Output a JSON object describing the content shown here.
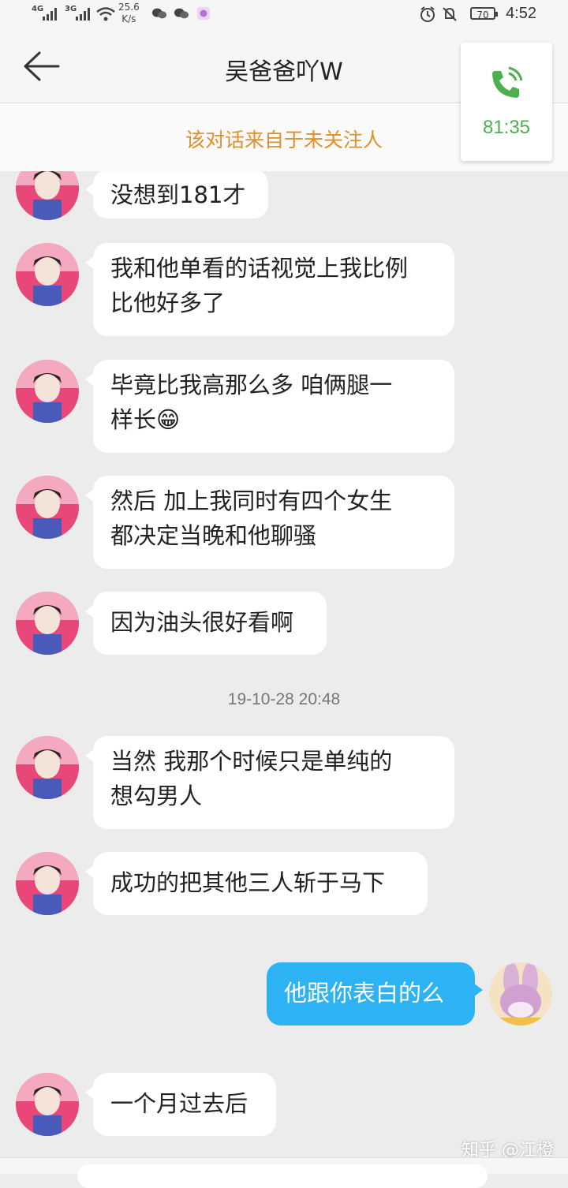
{
  "status_bar": {
    "sim1": "4G",
    "sim2": "3G",
    "speed_value": "25.6",
    "speed_unit": "K/s",
    "battery": "70",
    "time": "4:52",
    "icons": [
      "signal-icon",
      "wifi-icon",
      "wechat-icon",
      "wechat-icon",
      "app-icon",
      "alarm-icon",
      "mute-icon",
      "battery-icon"
    ]
  },
  "header": {
    "title": "吴爸爸吖W",
    "back_icon": "back-arrow-icon"
  },
  "notice": "该对话来自于未关注人",
  "call_card": {
    "icon": "phone-icon",
    "duration": "81:35",
    "accent": "#4caf50"
  },
  "messages": [
    {
      "side": "left",
      "lines": [
        "没想到181才"
      ]
    },
    {
      "side": "left",
      "lines": [
        "我和他单看的话视觉上我比例",
        "比他好多了"
      ]
    },
    {
      "side": "left",
      "lines": [
        "毕竟比我高那么多 咱俩腿一",
        "样长😁"
      ]
    },
    {
      "side": "left",
      "lines": [
        "然后 加上我同时有四个女生",
        "都决定当晚和他聊骚"
      ]
    },
    {
      "side": "left",
      "lines": [
        "因为油头很好看啊"
      ]
    },
    {
      "timestamp": "19-10-28 20:48"
    },
    {
      "side": "left",
      "lines": [
        "当然 我那个时候只是单纯的",
        "想勾男人"
      ]
    },
    {
      "side": "left",
      "lines": [
        "成功的把其他三人斩于马下"
      ]
    },
    {
      "side": "right",
      "lines": [
        "他跟你表白的么"
      ]
    },
    {
      "side": "left",
      "lines": [
        "一个月过去后"
      ]
    }
  ],
  "watermark": "知乎 @江橙",
  "colors": {
    "bubble_self": "#2db3f4",
    "notice_text": "#e0902a"
  }
}
